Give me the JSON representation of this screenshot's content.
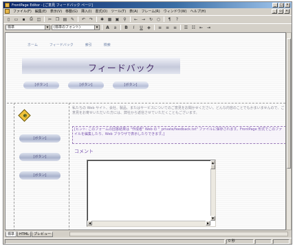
{
  "window": {
    "title": "FrontPage Editor - [ご意見 フィードバック ページ]"
  },
  "menubar": {
    "items": [
      "ファイル(F)",
      "編集(E)",
      "表示(V)",
      "移動(G)",
      "挿入(I)",
      "書式(O)",
      "ツール(T)",
      "表(A)",
      "フレーム(R)",
      "ウィンドウ(W)",
      "ヘルプ(H)"
    ]
  },
  "format_toolbar": {
    "style_value": "標準",
    "font_value": "(標準のフォント)"
  },
  "page": {
    "nav_links": [
      "ホーム",
      "フィードバック",
      "索引",
      "検索"
    ],
    "banner_title": "フィードバック",
    "top_buttons": [
      "[ボタン]",
      "[ボタン]",
      "[ボタン]"
    ],
    "side_buttons": [
      "[ボタン]",
      "[ボタン]",
      "[ボタン]"
    ],
    "intro_text": "私たちの Web サイト、会社、製品、またはサービスについてのご意見をお聞かせください。どんな内容のことでもかまいませんので、ご意見をお寄せいただいた方には、弊社から返信させていただくこともございます。",
    "selected_paragraph": "[ヒント: このフォームの回答結果は \"作成者\" Web の \"_private/feedback.txt\" ファイルに保存されます。FrontPage 形式でこのファイルを編集したり、Web ブラウザで表示したりできます。]",
    "comment_label": "コメント"
  },
  "view_tabs": [
    "標準",
    "HTML",
    "プレビュー"
  ],
  "status": {
    "right_text": "0 秒"
  },
  "colors": {
    "title_bar": "#0a246a",
    "banner_text": "#4a2f6b",
    "selected_text": "#7b55b0",
    "chrome": "#d4d0c8"
  }
}
